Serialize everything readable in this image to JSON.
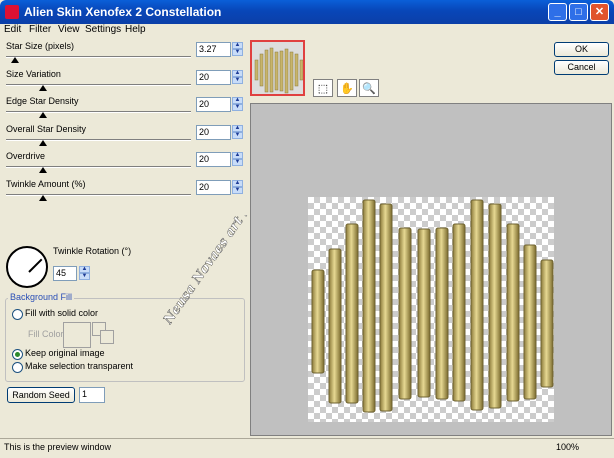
{
  "window": {
    "title": "Alien Skin Xenofex 2 Constellation",
    "controls": {
      "minimize": "_",
      "maximize": "□",
      "close": "✕"
    }
  },
  "menu": [
    "Edit",
    "Filter",
    "View",
    "Settings",
    "Help"
  ],
  "sliders": [
    {
      "label": "Star Size (pixels)",
      "value": "3.27",
      "fraction": 0.05
    },
    {
      "label": "Size Variation",
      "value": "20",
      "fraction": 0.2
    },
    {
      "label": "Edge Star Density",
      "value": "20",
      "fraction": 0.2
    },
    {
      "label": "Overall Star Density",
      "value": "20",
      "fraction": 0.2
    },
    {
      "label": "Overdrive",
      "value": "20",
      "fraction": 0.2
    },
    {
      "label": "Twinkle Amount (%)",
      "value": "20",
      "fraction": 0.2
    }
  ],
  "twinkle_rotation": {
    "label": "Twinkle Rotation (°)",
    "value": "45"
  },
  "background_fill": {
    "title": "Background Fill",
    "options": [
      {
        "label": "Fill with solid color",
        "checked": false
      },
      {
        "label": "Keep original image",
        "checked": true
      },
      {
        "label": "Make selection transparent",
        "checked": false
      }
    ],
    "fill_color_label": "Fill Color"
  },
  "random_seed": {
    "label": "Random Seed",
    "value": "1"
  },
  "buttons": {
    "ok": "OK",
    "cancel": "Cancel"
  },
  "tools": [
    "preview-select-icon",
    "hand-icon",
    "zoom-icon"
  ],
  "watermark": "Neusa Novaes art by",
  "status": {
    "text": "This is the preview window",
    "zoom": "100%"
  }
}
